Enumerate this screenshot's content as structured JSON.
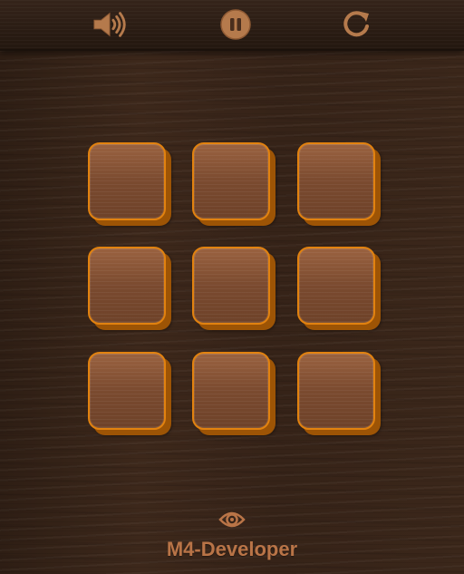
{
  "toolbar": {
    "sound_icon": "speaker-volume-icon",
    "pause_icon": "pause-icon",
    "restart_icon": "restart-icon"
  },
  "board": {
    "rows": 3,
    "cols": 3,
    "tiles": [
      "",
      "",
      "",
      "",
      "",
      "",
      "",
      "",
      ""
    ]
  },
  "footer": {
    "eye_icon": "eye-icon",
    "credit": "M4-Developer"
  },
  "colors": {
    "accent": "#e2820f",
    "text": "#b97447",
    "background": "#3b2619"
  }
}
